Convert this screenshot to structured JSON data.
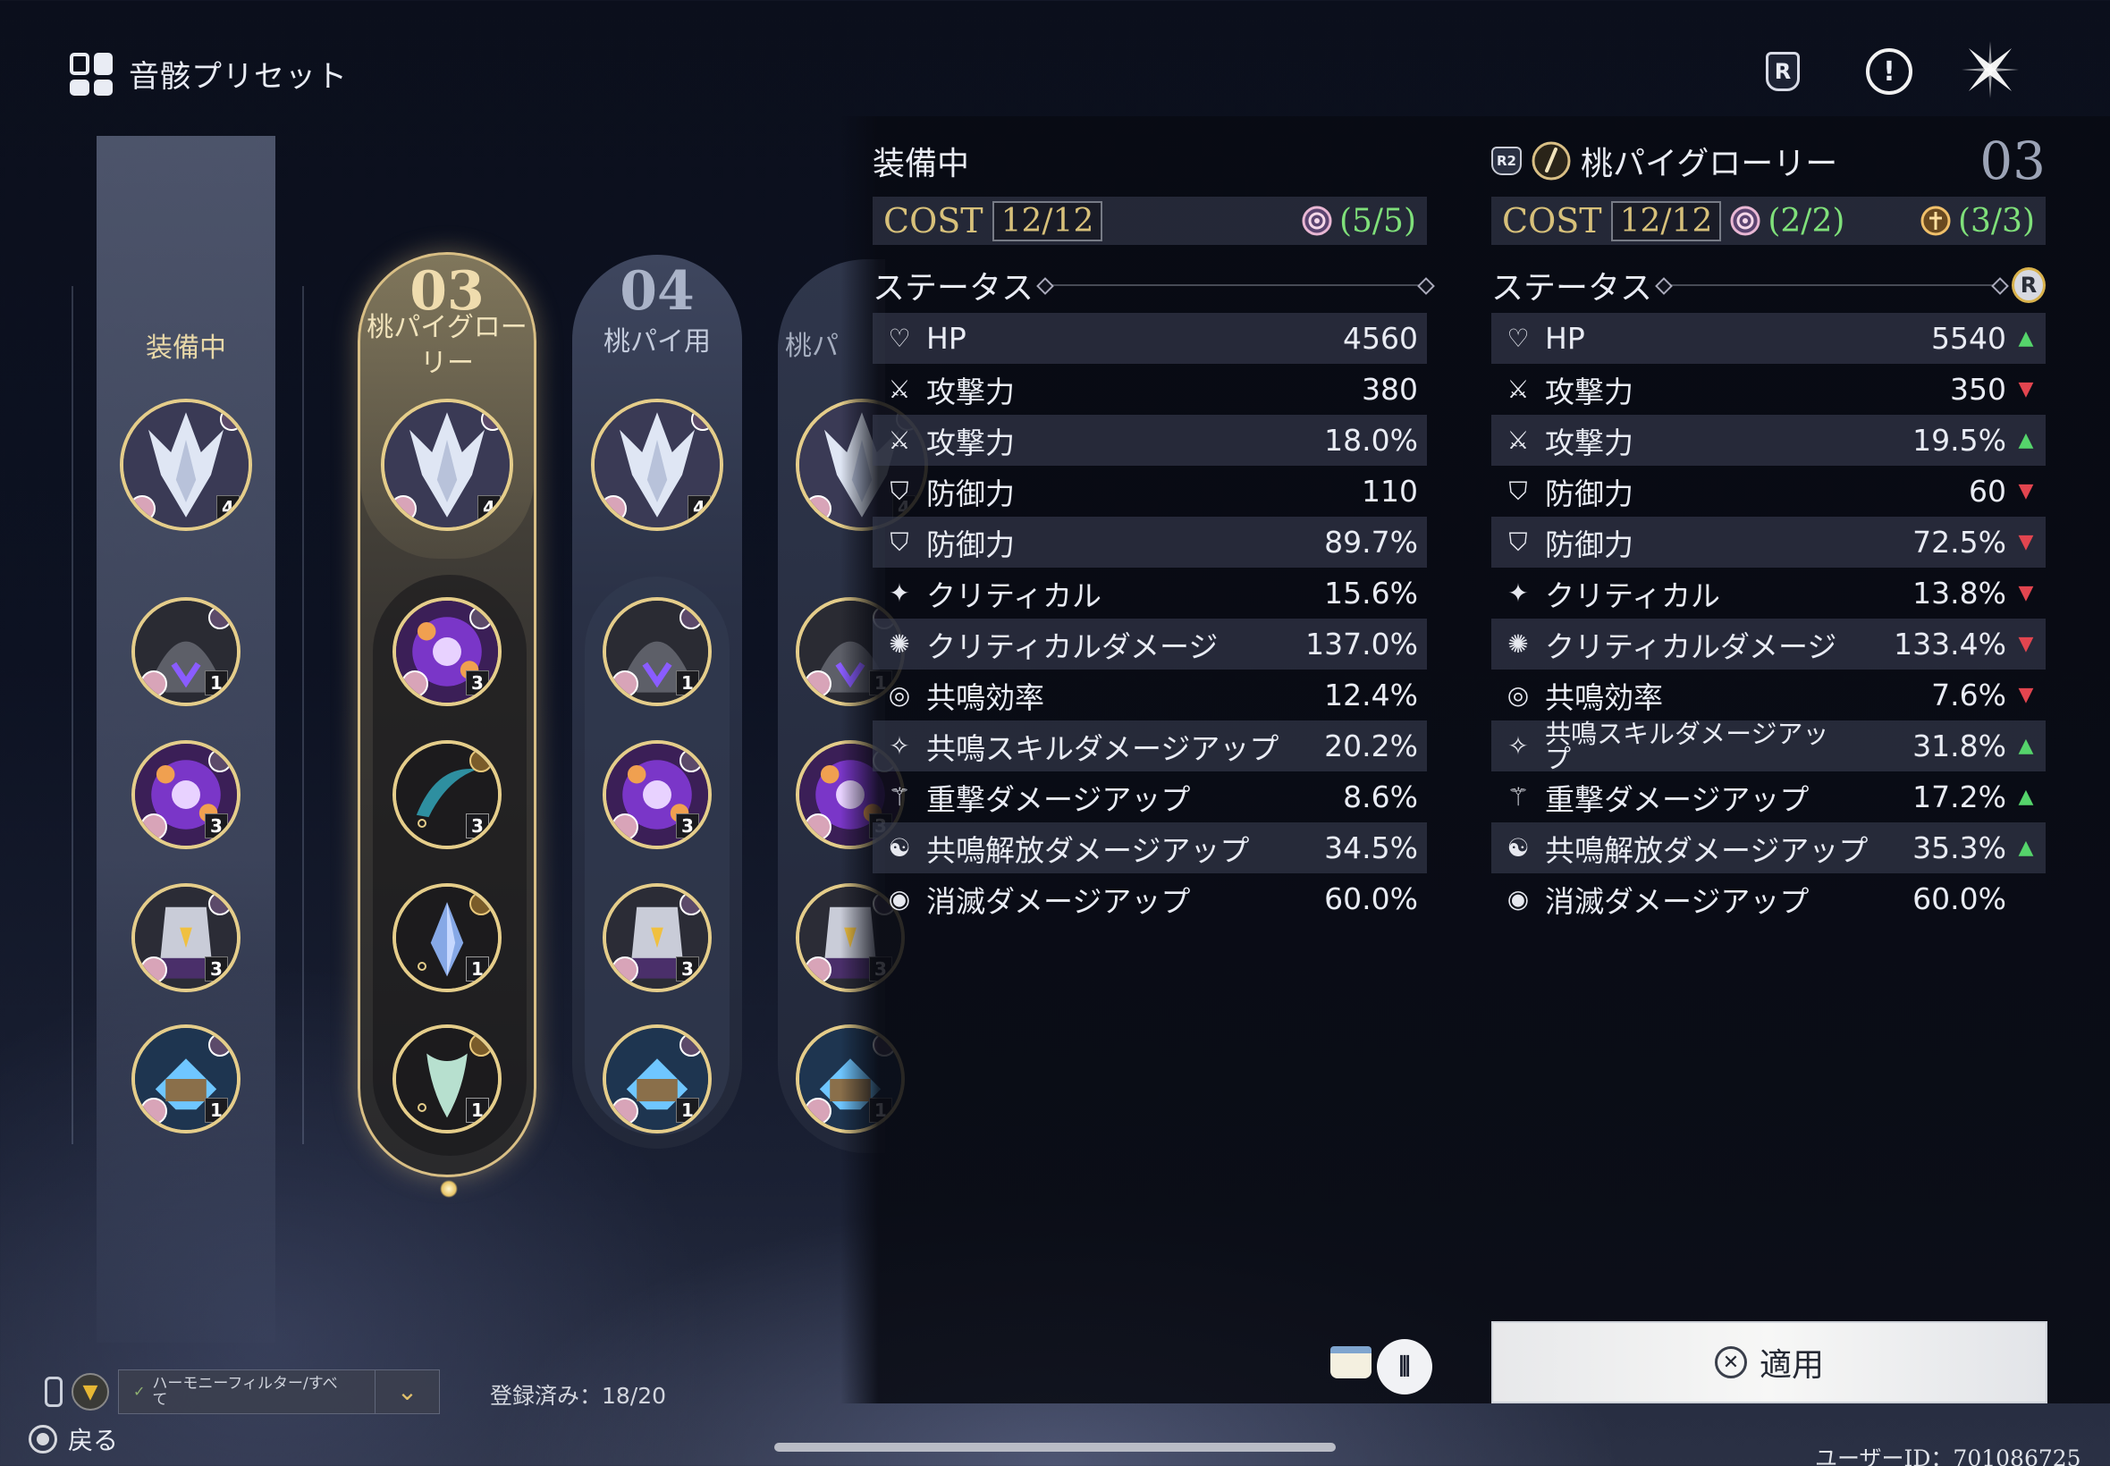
{
  "header": {
    "title": "音骸プリセット"
  },
  "columns": {
    "equipped_label": "装備中",
    "presets": [
      {
        "number": "03",
        "name": "桃パイグロー\nリー"
      },
      {
        "number": "04",
        "name": "桃パイ用"
      },
      {
        "name": "桃パ"
      }
    ]
  },
  "echo_levels": {
    "equipped": [
      "4",
      "1",
      "3",
      "3",
      "1"
    ],
    "p03": [
      "4",
      "3",
      "3",
      "1",
      "1"
    ],
    "p04": [
      "4",
      "1",
      "3",
      "3",
      "1"
    ]
  },
  "left_panel": {
    "title": "装備中",
    "cost_label": "COST",
    "cost_value": "12/12",
    "set1_count": "(5/5)",
    "status_label": "ステータス",
    "stats": [
      {
        "name": "HP",
        "value": "4560",
        "icon": "heart-icon"
      },
      {
        "name": "攻撃力",
        "value": "380",
        "icon": "swords-icon"
      },
      {
        "name": "攻撃力",
        "value": "18.0%",
        "icon": "swords-icon"
      },
      {
        "name": "防御力",
        "value": "110",
        "icon": "shield-icon"
      },
      {
        "name": "防御力",
        "value": "89.7%",
        "icon": "shield-icon"
      },
      {
        "name": "クリティカル",
        "value": "15.6%",
        "icon": "crit-icon"
      },
      {
        "name": "クリティカルダメージ",
        "value": "137.0%",
        "icon": "crit-dmg-icon"
      },
      {
        "name": "共鳴効率",
        "value": "12.4%",
        "icon": "energy-icon"
      },
      {
        "name": "共鳴スキルダメージアップ",
        "value": "20.2%",
        "icon": "skill-icon"
      },
      {
        "name": "重撃ダメージアップ",
        "value": "8.6%",
        "icon": "heavy-icon"
      },
      {
        "name": "共鳴解放ダメージアップ",
        "value": "34.5%",
        "icon": "liberation-icon"
      },
      {
        "name": "消滅ダメージアップ",
        "value": "60.0%",
        "icon": "havoc-icon"
      }
    ]
  },
  "right_panel": {
    "rank_badge": "R2",
    "title": "桃パイグローリー",
    "number": "03",
    "cost_label": "COST",
    "cost_value": "12/12",
    "set1_count": "(2/2)",
    "set2_count": "(3/3)",
    "status_label": "ステータス",
    "status_badge": "R",
    "stats": [
      {
        "name": "HP",
        "value": "5540",
        "trend": "up"
      },
      {
        "name": "攻撃力",
        "value": "350",
        "trend": "down"
      },
      {
        "name": "攻撃力",
        "value": "19.5%",
        "trend": "up"
      },
      {
        "name": "防御力",
        "value": "60",
        "trend": "down"
      },
      {
        "name": "防御力",
        "value": "72.5%",
        "trend": "down"
      },
      {
        "name": "クリティカル",
        "value": "13.8%",
        "trend": "down"
      },
      {
        "name": "クリティカルダメージ",
        "value": "133.4%",
        "trend": "down"
      },
      {
        "name": "共鳴効率",
        "value": "7.6%",
        "trend": "down"
      },
      {
        "name": "共鳴スキルダメージアッ\nプ",
        "value": "31.8%",
        "trend": "up"
      },
      {
        "name": "重撃ダメージアップ",
        "value": "17.2%",
        "trend": "up"
      },
      {
        "name": "共鳴解放ダメージアップ",
        "value": "35.3%",
        "trend": "up"
      },
      {
        "name": "消滅ダメージアップ",
        "value": "60.0%",
        "trend": ""
      }
    ]
  },
  "bottom": {
    "apply_label": "適用",
    "filter_text": "ハーモニーフィルター/すべ\nて",
    "registered": "登録済み：18/20",
    "back_label": "戻る",
    "user_id": "ユーザーID：701086725"
  },
  "colors": {
    "accent_gold": "#d9bf85",
    "stat_up": "#55d46b",
    "stat_down": "#e2454f",
    "set_count_green": "#7fe07a"
  }
}
